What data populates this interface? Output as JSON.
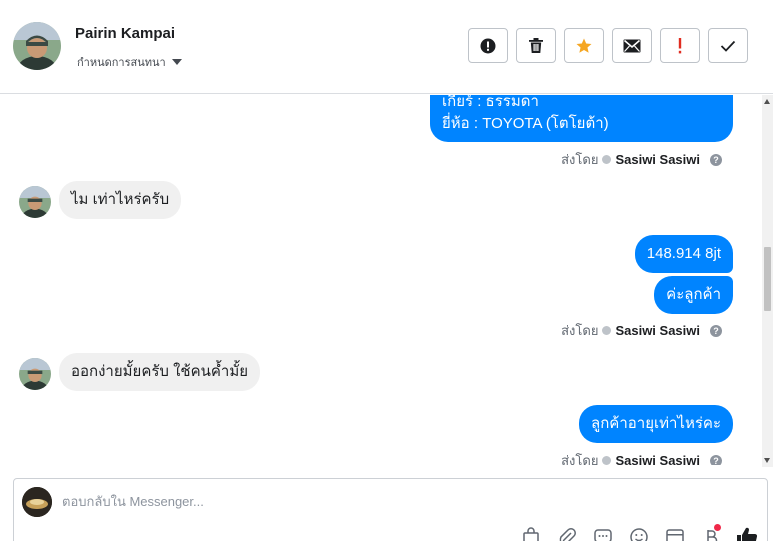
{
  "header": {
    "contact_name": "Pairin Kampai",
    "status_label": "กำหนดการสนทนา",
    "actions": [
      {
        "name": "report-spam",
        "icon": "exclamation-circle-icon"
      },
      {
        "name": "delete",
        "icon": "trash-icon"
      },
      {
        "name": "star",
        "icon": "star-icon",
        "color": "#f5a623"
      },
      {
        "name": "mark-unread",
        "icon": "envelope-icon"
      },
      {
        "name": "follow-up",
        "icon": "exclamation-icon",
        "color": "#e02d21"
      },
      {
        "name": "mark-done",
        "icon": "checkmark-icon"
      }
    ]
  },
  "messages": [
    {
      "direction": "out",
      "lines": [
        "เกียร์ : ธรรมดา",
        "ยี่ห้อ : TOYOTA (โตโยต้า)"
      ]
    },
    {
      "direction": "sent_by",
      "label": "ส่งโดย",
      "agent": "Sasiwi Sasiwi"
    },
    {
      "direction": "in",
      "text": "ไม เท่าไหร่ครับ"
    },
    {
      "direction": "out",
      "text": "148.914 8jt"
    },
    {
      "direction": "out",
      "text": "ค่ะลูกค้า"
    },
    {
      "direction": "sent_by",
      "label": "ส่งโดย",
      "agent": "Sasiwi Sasiwi"
    },
    {
      "direction": "in",
      "text": "ออกง่ายมั้ยครับ ใช้คนค้ำมั้ย"
    },
    {
      "direction": "out",
      "text": "ลูกค้าอายุเท่าไหร่คะ"
    },
    {
      "direction": "sent_by",
      "label": "ส่งโดย",
      "agent": "Sasiwi Sasiwi"
    }
  ],
  "composer": {
    "placeholder": "ตอบกลับใน Messenger...",
    "tools": [
      "shopping-bag-icon",
      "paperclip-icon",
      "saved-replies-icon",
      "emoji-icon",
      "calendar-icon",
      "baht-icon",
      "like-icon"
    ]
  },
  "colors": {
    "outgoing_bubble": "#0084ff",
    "incoming_bubble": "#f0f0f0",
    "accent": "#0084ff"
  }
}
